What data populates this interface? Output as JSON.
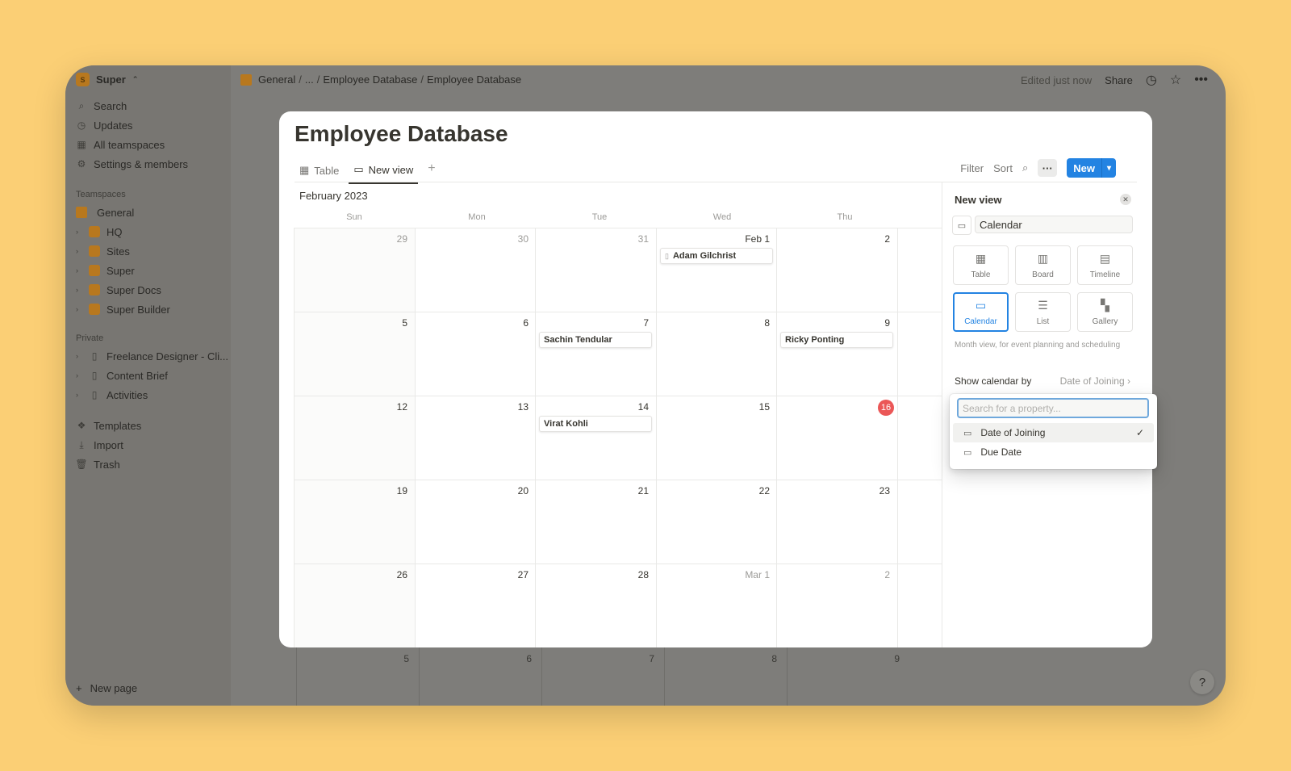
{
  "workspace": {
    "name": "Super",
    "logo": "S"
  },
  "sidebar": {
    "top_items": [
      {
        "label": "Search",
        "icon": "search-icon"
      },
      {
        "label": "Updates",
        "icon": "clock-icon"
      },
      {
        "label": "All teamspaces",
        "icon": "building-icon"
      },
      {
        "label": "Settings & members",
        "icon": "gear-icon"
      }
    ],
    "teamspaces_heading": "Teamspaces",
    "teamspaces": [
      {
        "label": "General"
      },
      {
        "label": "HQ"
      },
      {
        "label": "Sites"
      },
      {
        "label": "Super"
      },
      {
        "label": "Super Docs"
      },
      {
        "label": "Super Builder"
      }
    ],
    "private_heading": "Private",
    "private": [
      {
        "label": "Freelance Designer - Cli..."
      },
      {
        "label": "Content Brief"
      },
      {
        "label": "Activities"
      }
    ],
    "bottom_items": [
      {
        "label": "Templates"
      },
      {
        "label": "Import"
      },
      {
        "label": "Trash"
      }
    ],
    "new_page": "New page"
  },
  "breadcrumb": {
    "items": [
      "General",
      "...",
      "Employee Database",
      "Employee Database"
    ],
    "sep": "/"
  },
  "topbar": {
    "edited": "Edited just now",
    "share": "Share"
  },
  "page": {
    "title": "Employee Database",
    "tabs": [
      {
        "label": "Table"
      },
      {
        "label": "New view"
      }
    ],
    "toolbar": {
      "filter": "Filter",
      "sort": "Sort",
      "more": "···",
      "new": "New"
    }
  },
  "calendar": {
    "month": "February 2023",
    "days": [
      "Sun",
      "Mon",
      "Tue",
      "Wed",
      "Thu"
    ],
    "weeks": [
      [
        "29",
        "30",
        "31",
        "Feb 1",
        "2"
      ],
      [
        "5",
        "6",
        "7",
        "8",
        "9"
      ],
      [
        "12",
        "13",
        "14",
        "15",
        "16"
      ],
      [
        "19",
        "20",
        "21",
        "22",
        "23"
      ],
      [
        "26",
        "27",
        "28",
        "Mar 1",
        "2"
      ],
      [
        "5",
        "6",
        "7",
        "8",
        "9"
      ]
    ],
    "events": [
      {
        "week": 0,
        "day": 3,
        "name": "Adam Gilchrist"
      },
      {
        "week": 1,
        "day": 2,
        "name": "Sachin Tendular"
      },
      {
        "week": 1,
        "day": 4,
        "name": "Ricky Ponting"
      },
      {
        "week": 2,
        "day": 2,
        "name": "Virat Kohli"
      }
    ],
    "today": "16"
  },
  "panel": {
    "title": "New view",
    "name_value": "Calendar",
    "types": [
      {
        "label": "Table",
        "icon": "table-icon"
      },
      {
        "label": "Board",
        "icon": "board-icon"
      },
      {
        "label": "Timeline",
        "icon": "timeline-icon"
      },
      {
        "label": "Calendar",
        "icon": "calendar-icon",
        "selected": true
      },
      {
        "label": "List",
        "icon": "list-icon"
      },
      {
        "label": "Gallery",
        "icon": "gallery-icon"
      }
    ],
    "description": "Month view, for event planning and scheduling",
    "show_by_label": "Show calendar by",
    "show_by_value": "Date of Joining"
  },
  "dropdown": {
    "placeholder": "Search for a property...",
    "items": [
      {
        "label": "Date of Joining",
        "checked": true
      },
      {
        "label": "Due Date"
      }
    ]
  },
  "colors": {
    "accent": "#2383e2",
    "today": "#eb5757",
    "background": "#FBCF75",
    "teamspace_icon": "#b8781e"
  },
  "help": "?"
}
